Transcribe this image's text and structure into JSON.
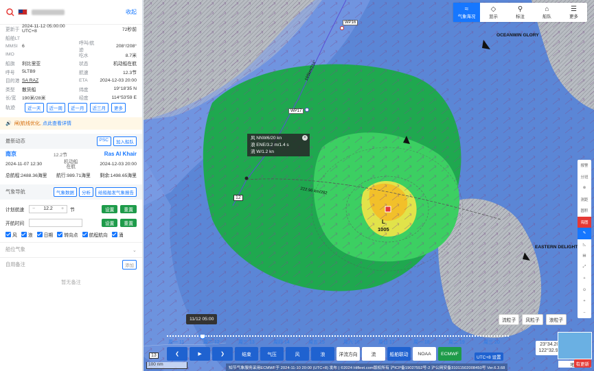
{
  "panel": {
    "collapse_label": "收起",
    "rows": [
      {
        "k": "更新于",
        "v": "2024-11-12 05:00:00 UTC+8",
        "k2": "",
        "v2": "72秒前"
      },
      {
        "k": "船舶LT",
        "v": "",
        "k2": "",
        "v2": ""
      },
      {
        "k": "MMSI",
        "v": "6",
        "k2": "呼叫/航迹",
        "v2": "208°/208°"
      },
      {
        "k": "IMO",
        "v": "",
        "k2": "吃水",
        "v2": "8.7米"
      },
      {
        "k": "船旗",
        "v": "利比里亚",
        "k2": "状态",
        "v2": "机动船在航"
      },
      {
        "k": "呼号",
        "v": "5LTB9",
        "k2": "航速",
        "v2": "12.3节"
      },
      {
        "k": "目的港",
        "v": "SA RAZ",
        "k2": "ETA",
        "v2": "2024-12-03 20:00"
      },
      {
        "k": "类型",
        "v": "散货船",
        "k2": "纬度",
        "v2": "19°18'35 N"
      },
      {
        "k": "长/宽",
        "v": "190米/28米",
        "k2": "经度",
        "v2": "114°53'59 E"
      }
    ],
    "track_label": "轨迹",
    "track_buttons": [
      "近一天",
      "近一周",
      "近一月",
      "近三月",
      "更多"
    ],
    "notice_text": "闸(航线优化,",
    "notice_link": "点此查看详情",
    "dynamics": {
      "title": "最新动态",
      "btn_psc": "PSC",
      "btn_fleet": "加入船队",
      "from_port": "南京",
      "speed": "12.2节",
      "to_port": "Ras Al Khair",
      "depart_time": "2024-11-07 12:30",
      "status": "机动船在航",
      "eta": "2024-12-03 20:00",
      "total": "总航程:2488.36海里",
      "sailed": "航行:989.71海里",
      "remain": "剩余:1498.65海里"
    },
    "weather_nav": {
      "title": "气象导航",
      "btn_data": "气象数据",
      "btn_analysis": "分析",
      "btn_report": "给船舶发气象报告",
      "plan_speed_label": "计划航速",
      "plan_speed_value": "12.2",
      "plan_speed_unit": "节",
      "set_label": "设置",
      "reset_label": "重置",
      "start_label": "开航时间",
      "checks": [
        "风",
        "浪",
        "日期",
        "转向点",
        "航程航向",
        "涌"
      ]
    },
    "ship_weather_title": "船位气象",
    "notes_title": "自用备注",
    "notes_add": "添加",
    "notes_empty": "暂无备注"
  },
  "topbar": [
    {
      "label": "气象海况",
      "icon": "≈"
    },
    {
      "label": "显示",
      "icon": "◇"
    },
    {
      "label": "标注",
      "icon": "⚲"
    },
    {
      "label": "船队",
      "icon": "⌂"
    },
    {
      "label": "更多",
      "icon": "☰"
    }
  ],
  "right_tools": [
    "报警",
    "分班",
    "⊗",
    "测距",
    "圆积",
    "海图",
    "✎",
    "◺",
    "▤",
    "⤢",
    "+",
    "⊙",
    "+",
    "−"
  ],
  "map_labels": {
    "waypoints": [
      "WP16",
      "WP17",
      "12",
      "13"
    ],
    "ship1": "OCEANWIN GLORY",
    "ship2": "EASTERN DELIGHT",
    "pressure": "1005",
    "low": "L",
    "route_km1": "222.96 km/282",
    "route_km2": "165km/234°"
  },
  "wx_popup": {
    "wind": "风 NNW6/20 kn",
    "wave": "浪 ENE/3.2 m/1.4 s",
    "current": "流 W/1.2 kn"
  },
  "particle_buttons": [
    "流粒子",
    "风粒子",
    "浪粒子"
  ],
  "coords": {
    "lat": "23°34.209 N",
    "lon": "122°32.939 E"
  },
  "minimap_label": "地图",
  "update_badge": "有更新",
  "time_tip": "11/12 05:00",
  "timeline_days": [
    "周一 11",
    "周二 12",
    "周三 13",
    "周四 14",
    "周五 15",
    "周六 16",
    "周日 17",
    "周一 18",
    "周二 19",
    "周三 20"
  ],
  "controls": [
    "结束",
    "气压",
    "风",
    "浪",
    "洋流方向",
    "流",
    "船舶联动",
    "NOAA",
    "ECMWF"
  ],
  "tz_label": "UTC+8 设置",
  "scale_label": "100 nm",
  "footer": "知节气象服务采用ECMWF于 2024-11-10 20:00 (UTC+8) 发布 | ©2024 Hifleet.com版权所有 沪ICP备19027552号-2 沪公网安备31011502008450号  Ver.6.3.68"
}
